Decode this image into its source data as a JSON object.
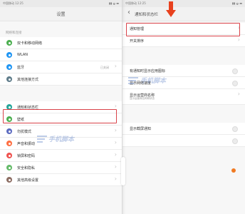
{
  "left_screen": {
    "status": {
      "carrier": "中国移动 12:25",
      "signals": "▮▮ ◒ ▬"
    },
    "title": "设置",
    "section_label": "网络和连接",
    "items": [
      {
        "label": "双卡和移动网络",
        "icon": "sim-card-icon",
        "color": "#4caf50"
      },
      {
        "label": "WLAN",
        "icon": "wifi-icon",
        "color": "#2196f3"
      },
      {
        "label": "蓝牙",
        "icon": "bluetooth-icon",
        "color": "#2196f3",
        "value": "已关闭"
      },
      {
        "label": "其他连接方式",
        "icon": "more-connections-icon",
        "color": "#607d8b"
      },
      {
        "label": "通知和状态栏",
        "icon": "notification-icon",
        "color": "#26a69a"
      },
      {
        "label": "壁纸",
        "icon": "wallpaper-icon",
        "color": "#4caf50"
      },
      {
        "label": "勿扰模式",
        "icon": "do-not-disturb-icon",
        "color": "#5c6bc0"
      },
      {
        "label": "声音和振动",
        "icon": "sound-icon",
        "color": "#ff7043"
      },
      {
        "label": "锁屏和密码",
        "icon": "lock-icon",
        "color": "#ef5350"
      },
      {
        "label": "安全和隐私",
        "icon": "security-icon",
        "color": "#66bb6a"
      },
      {
        "label": "其他高级设置",
        "icon": "advanced-settings-icon",
        "color": "#8d6e63"
      }
    ]
  },
  "right_screen": {
    "status": {
      "carrier": "中国移动 12:25",
      "signals": "▮▮ ◒ ▬"
    },
    "back_glyph": "‹",
    "title": "通知和状态栏",
    "items": [
      {
        "label": "通知管理"
      },
      {
        "label": "开关排序"
      },
      {
        "label": ""
      },
      {
        "label": "有通知时显示应用图标"
      },
      {
        "label": "显示网络速度"
      },
      {
        "label": "显示运营商名称",
        "sub": "显示运营商名称和状态"
      },
      {
        "label": ""
      },
      {
        "label": "显示截屏通知"
      }
    ]
  },
  "watermark": {
    "text": "手机脚本",
    "text2": "手机脚本"
  },
  "colors": {
    "highlight": "#d9434a",
    "arrow": "#e8411e",
    "dot": "#f07a22"
  }
}
